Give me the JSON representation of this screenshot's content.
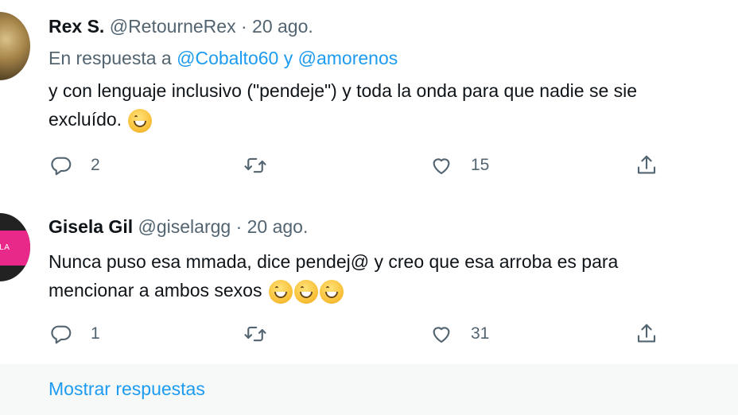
{
  "replies": [
    {
      "name": "Rex S.",
      "meta": "@RetourneRex · 20 ago.",
      "reply_to_prefix": "En respuesta a ",
      "reply_to_mention1": "@Cobalto60",
      "reply_to_sep": " y ",
      "reply_to_mention2": "@amorenos",
      "text_line1": "y con lenguaje inclusivo (\"pendeje\") y toda la onda para que nadie se sie",
      "text_line2": "excluído. ",
      "emoji": "grinning-face-smiling-eyes",
      "reply_count": "2",
      "retweet_count": "",
      "like_count": "15"
    },
    {
      "name": "Gisela Gil",
      "meta": "@giselargg · 20 ago.",
      "avatar_text": "ELA",
      "text_line1": "Nunca puso esa mmada, dice pendej@ y creo que esa arroba es para",
      "text_line2": "mencionar a ambos sexos ",
      "emoji": "grinning-face-smiling-eyes",
      "reply_count": "1",
      "retweet_count": "",
      "like_count": "31"
    }
  ],
  "show_replies_label": "Mostrar respuestas",
  "colors": {
    "accent": "#1d9bf0",
    "muted": "#536471",
    "text": "#0f1419"
  }
}
